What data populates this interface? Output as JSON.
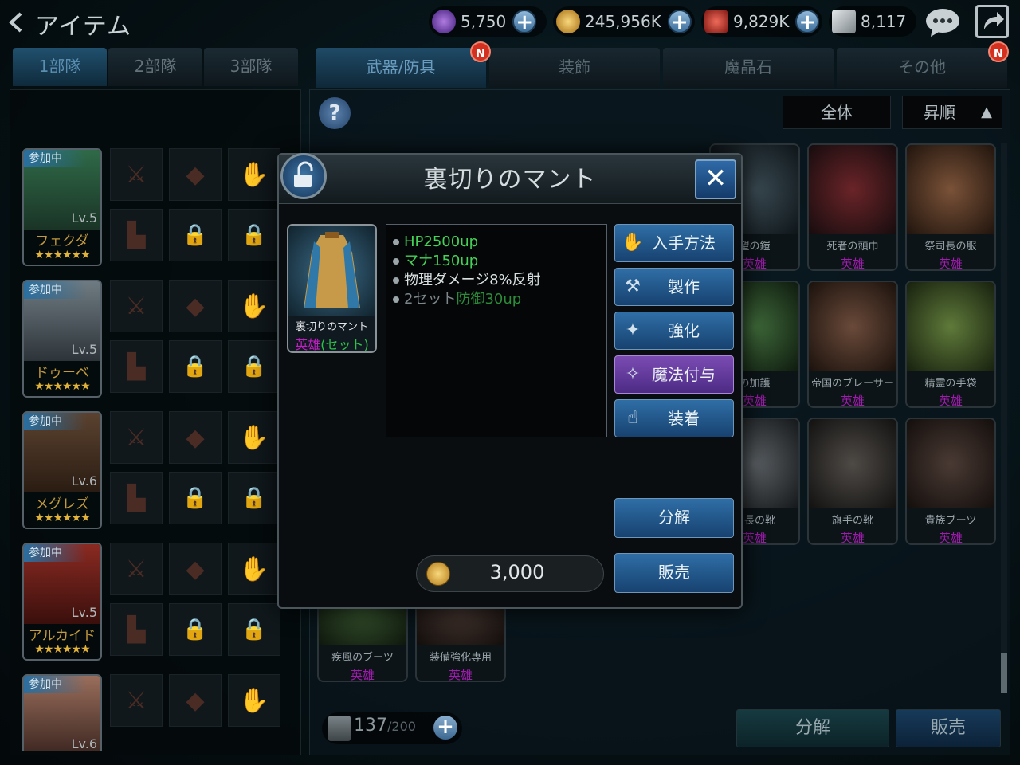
{
  "header": {
    "title": "アイテム",
    "currencies": [
      {
        "icon": "crystal-icon",
        "amount": "5,750"
      },
      {
        "icon": "gold-coin-icon",
        "amount": "245,956K"
      },
      {
        "icon": "ruby-icon",
        "amount": "9,829K"
      },
      {
        "icon": "silver-ticket-icon",
        "amount": "8,117"
      }
    ]
  },
  "party_tabs": [
    "1部隊",
    "2部隊",
    "3部隊"
  ],
  "party": [
    {
      "status": "参加中",
      "level": "Lv.5",
      "name": "フェクダ",
      "stars": "★★★★★★"
    },
    {
      "status": "参加中",
      "level": "Lv.5",
      "name": "ドゥーベ",
      "stars": "★★★★★★"
    },
    {
      "status": "参加中",
      "level": "Lv.6",
      "name": "メグレズ",
      "stars": "★★★★★★"
    },
    {
      "status": "参加中",
      "level": "Lv.5",
      "name": "アルカイド",
      "stars": "★★★★★★"
    },
    {
      "status": "参加中",
      "level": "Lv.6",
      "name": "",
      "stars": ""
    }
  ],
  "category_tabs": [
    "武器/防具",
    "装飾",
    "魔晶石",
    "その他"
  ],
  "badge": "N",
  "filters": {
    "all": "全体",
    "sort": "昇順"
  },
  "inventory": [
    {
      "name": "望の鎧",
      "rarity": "英雄"
    },
    {
      "name": "死者の頭巾",
      "rarity": "英雄"
    },
    {
      "name": "祭司長の服",
      "rarity": "英雄"
    },
    {
      "name": "の加護",
      "rarity": "英雄"
    },
    {
      "name": "帝国のブレーサー",
      "rarity": "英雄"
    },
    {
      "name": "精霊の手袋",
      "rarity": "英雄"
    },
    {
      "name": "団長の靴",
      "rarity": "英雄"
    },
    {
      "name": "旗手の靴",
      "rarity": "英雄"
    },
    {
      "name": "貴族ブーツ",
      "rarity": "英雄"
    },
    {
      "name": "疾風のブーツ",
      "rarity": "英雄"
    },
    {
      "name": "装備強化専用",
      "rarity": "英雄"
    }
  ],
  "capacity": {
    "current": "137",
    "max": "/200"
  },
  "bottom_actions": {
    "disassemble": "分解",
    "sell": "販売"
  },
  "dialog": {
    "title": "裏切りのマント",
    "item_name": "裏切りのマント",
    "rarity": "英雄",
    "set_label": "(セット)",
    "stats": [
      "HP2500up",
      "マナ150up",
      "物理ダメージ8%反射"
    ],
    "set_bonus_prefix": "2セット",
    "set_bonus_value": "防御30up",
    "actions": [
      {
        "label": "入手方法",
        "icon": "hand-obtain-icon"
      },
      {
        "label": "製作",
        "icon": "craft-hands-icon"
      },
      {
        "label": "強化",
        "icon": "enhance-sparkle-icon"
      },
      {
        "label": "魔法付与",
        "icon": "magic-enchant-icon"
      },
      {
        "label": "装着",
        "icon": "equip-hand-icon"
      }
    ],
    "disassemble": "分解",
    "sell": "販売",
    "price": "3,000",
    "colors": {
      "epic": "#c41ec6",
      "set": "#2ec24b",
      "stat_green": "#44d257",
      "button_blue": "#2f6ea6",
      "button_purple": "#7a4bb3"
    }
  }
}
